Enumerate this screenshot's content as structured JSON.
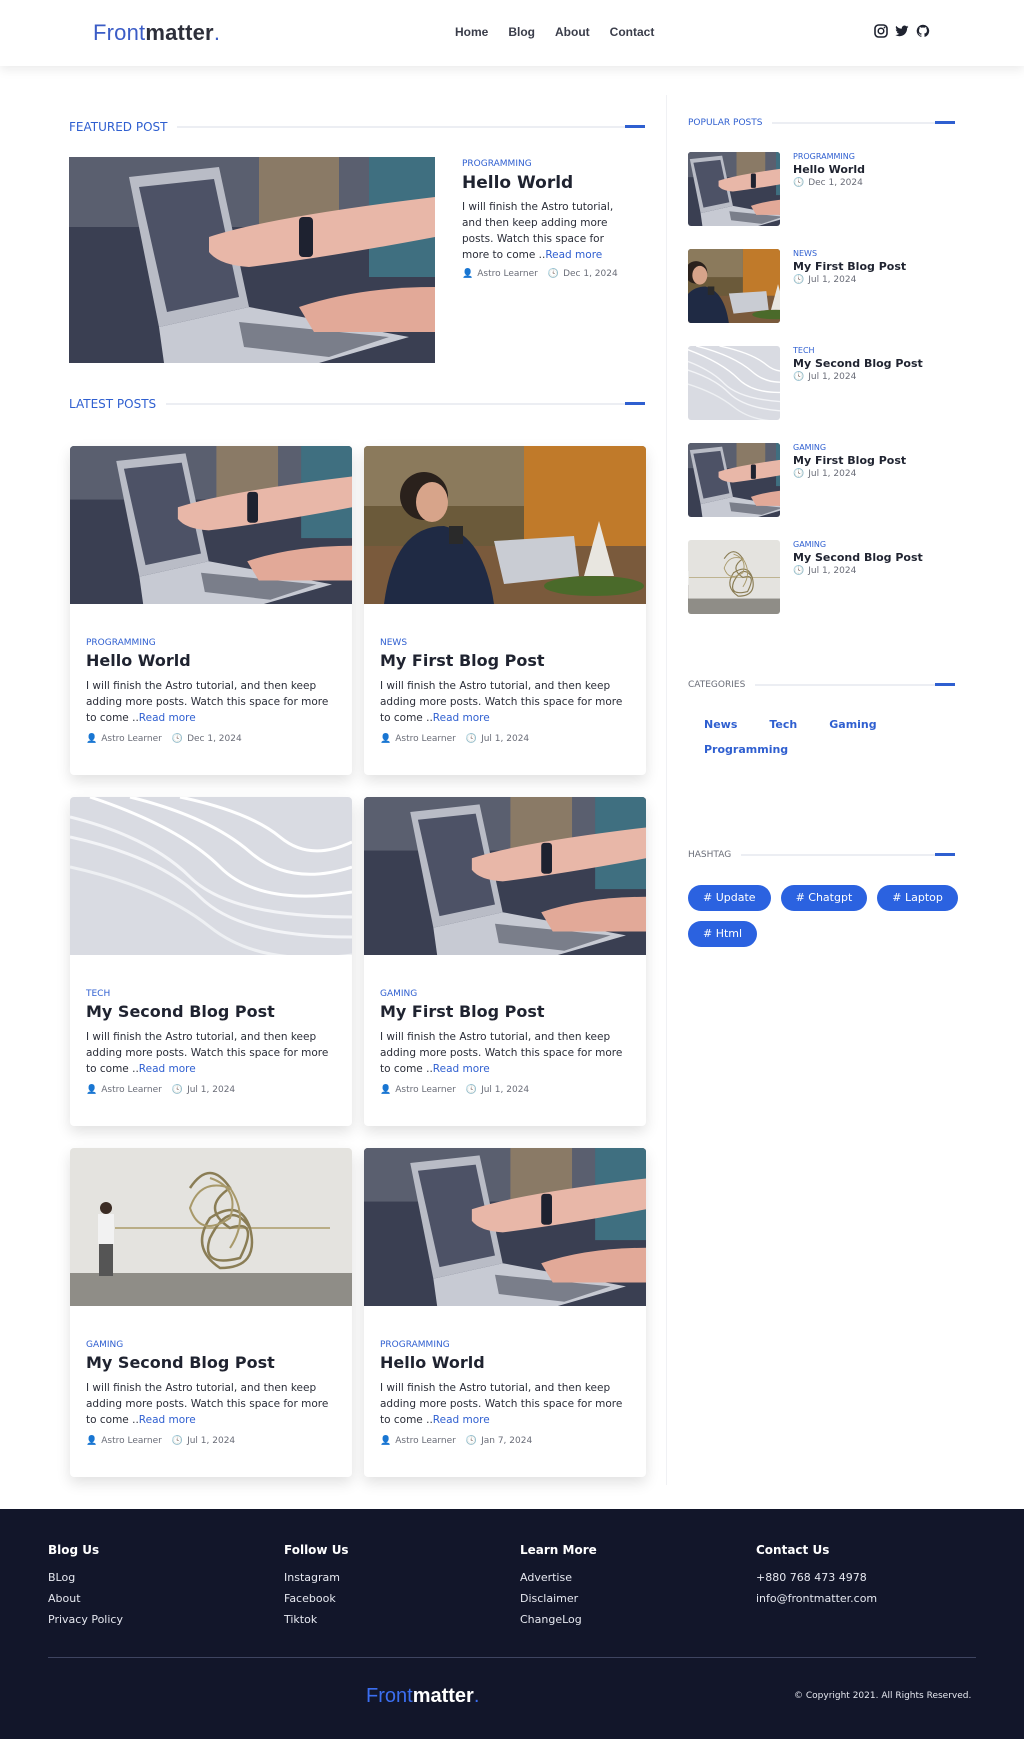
{
  "header": {
    "logo": {
      "front": "Front",
      "matter": "matter",
      "dot": "."
    },
    "nav": [
      "Home",
      "Blog",
      "About",
      "Contact"
    ],
    "social_icons": [
      "instagram-icon",
      "twitter-icon",
      "github-icon"
    ]
  },
  "featured": {
    "section_title": "FEATURED POST",
    "category": "PROGRAMMING",
    "title": "Hello World",
    "excerpt": "I will finish the Astro tutorial, and then keep adding more posts. Watch this space for more to come ..",
    "read_more": "Read more",
    "author": "Astro Learner",
    "date": "Dec 1, 2024"
  },
  "latest": {
    "section_title": "LATEST POSTS",
    "read_more": "Read more",
    "excerpt": "I will finish the Astro tutorial, and then keep adding more posts. Watch this space for more to come ..",
    "posts": [
      {
        "category": "PROGRAMMING",
        "title": "Hello World",
        "author": "Astro Learner",
        "date": "Dec 1, 2024"
      },
      {
        "category": "NEWS",
        "title": "My First Blog Post",
        "author": "Astro Learner",
        "date": "Jul 1, 2024"
      },
      {
        "category": "TECH",
        "title": "My Second Blog Post",
        "author": "Astro Learner",
        "date": "Jul 1, 2024"
      },
      {
        "category": "GAMING",
        "title": "My First Blog Post",
        "author": "Astro Learner",
        "date": "Jul 1, 2024"
      },
      {
        "category": "GAMING",
        "title": "My Second Blog Post",
        "author": "Astro Learner",
        "date": "Jul 1, 2024"
      },
      {
        "category": "PROGRAMMING",
        "title": "Hello World",
        "author": "Astro Learner",
        "date": "Jan 7, 2024"
      }
    ]
  },
  "sidebar": {
    "popular_title": "POPULAR POSTS",
    "popular": [
      {
        "category": "PROGRAMMING",
        "title": "Hello World",
        "date": "Dec 1, 2024"
      },
      {
        "category": "NEWS",
        "title": "My First Blog Post",
        "date": "Jul 1, 2024"
      },
      {
        "category": "TECH",
        "title": "My Second Blog Post",
        "date": "Jul 1, 2024"
      },
      {
        "category": "GAMING",
        "title": "My First Blog Post",
        "date": "Jul 1, 2024"
      },
      {
        "category": "GAMING",
        "title": "My Second Blog Post",
        "date": "Jul 1, 2024"
      }
    ],
    "categories_title": "CATEGORIES",
    "categories": [
      "News",
      "Tech",
      "Gaming",
      "Programming"
    ],
    "hashtag_title": "HASHTAG",
    "hashtags": [
      "# Update",
      "# Chatgpt",
      "# Laptop",
      "# Html"
    ]
  },
  "footer": {
    "columns": [
      {
        "title": "Blog Us",
        "items": [
          "BLog",
          "About",
          "Privacy Policy"
        ]
      },
      {
        "title": "Follow Us",
        "items": [
          "Instagram",
          "Facebook",
          "Tiktok"
        ]
      },
      {
        "title": "Learn More",
        "items": [
          "Advertise",
          "Disclaimer",
          "ChangeLog"
        ]
      },
      {
        "title": "Contact Us",
        "items": [
          "+880 768 473 4978",
          "info@frontmatter.com"
        ]
      }
    ],
    "logo": {
      "front": "Front",
      "matter": "matter",
      "dot": "."
    },
    "copyright": "© Copyright 2021. All Rights Reserved."
  },
  "colors": {
    "accent": "#2f5fd0",
    "tag_bg": "#2b62e0",
    "footer_bg": "#12162a"
  }
}
